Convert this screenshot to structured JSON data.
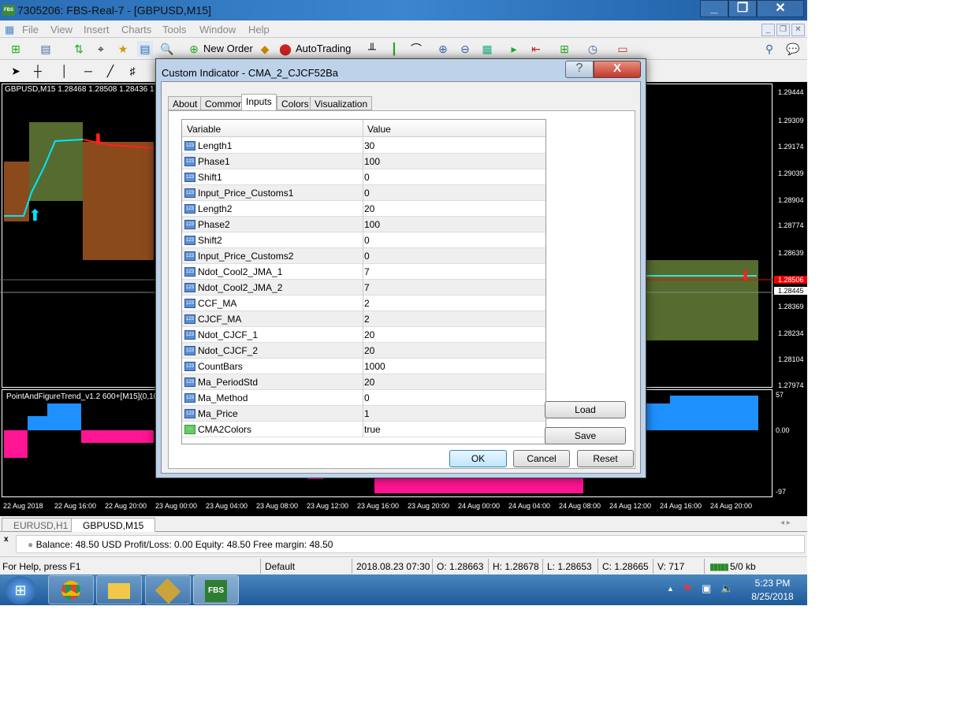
{
  "window": {
    "title": "7305206: FBS-Real-7 - [GBPUSD,M15]",
    "logo": "FBS"
  },
  "menu": [
    "File",
    "View",
    "Insert",
    "Charts",
    "Tools",
    "Window",
    "Help"
  ],
  "toolbar": {
    "new_order": "New Order",
    "autotrading": "AutoTrading"
  },
  "chart": {
    "header": "GBPUSD,M15  1.28468 1.28508 1.28436 1",
    "price_ticks": [
      "1.29444",
      "1.29309",
      "1.29174",
      "1.29039",
      "1.28904",
      "1.28774",
      "1.28639",
      "1.28369",
      "1.28234",
      "1.28104",
      "1.27974"
    ],
    "ask_price": "1.28506",
    "bid_price": "1.28445",
    "indicator_title": "PointAndFigureTrend_v1.2 600+[M15](0,10,",
    "indicator_ticks": [
      "57",
      "0.00",
      "-97"
    ],
    "time_ticks": [
      "22 Aug 2018",
      "22 Aug 16:00",
      "22 Aug 20:00",
      "23 Aug 00:00",
      "23 Aug 04:00",
      "23 Aug 08:00",
      "23 Aug 12:00",
      "23 Aug 16:00",
      "23 Aug 20:00",
      "24 Aug 00:00",
      "24 Aug 04:00",
      "24 Aug 08:00",
      "24 Aug 12:00",
      "24 Aug 16:00",
      "24 Aug 20:00"
    ],
    "colors": {
      "ask": "#ff0000",
      "background": "#000000",
      "box_orange": "#8b4a1c",
      "box_olive": "#556b2f",
      "trend_cyan": "#00e5ff",
      "pf_blue": "#1e90ff",
      "pf_pink": "#ff1493"
    }
  },
  "chart_tabs": [
    "EURUSD,H1",
    "GBPUSD,M15"
  ],
  "terminal": {
    "text": "Balance: 48.50 USD  Profit/Loss: 0.00  Equity: 48.50  Free margin: 48.50"
  },
  "status": {
    "help": "For Help, press F1",
    "profile": "Default",
    "datetime": "2018.08.23 07:30",
    "open": "O: 1.28663",
    "high": "H: 1.28678",
    "low": "L: 1.28653",
    "close": "C: 1.28665",
    "volume": "V: 717",
    "traffic": "5/0 kb"
  },
  "taskbar": {
    "time": "5:23 PM",
    "date": "8/25/2018",
    "fbs": "FBS"
  },
  "dialog": {
    "title": "Custom Indicator - CMA_2_CJCF52Ba",
    "tabs": [
      "About",
      "Common",
      "Inputs",
      "Colors",
      "Visualization"
    ],
    "active_tab": "Inputs",
    "columns": {
      "variable": "Variable",
      "value": "Value"
    },
    "rows": [
      {
        "name": "Length1",
        "value": "30"
      },
      {
        "name": "Phase1",
        "value": "100"
      },
      {
        "name": "Shift1",
        "value": "0"
      },
      {
        "name": "Input_Price_Customs1",
        "value": "0"
      },
      {
        "name": "Length2",
        "value": "20"
      },
      {
        "name": "Phase2",
        "value": "100"
      },
      {
        "name": "Shift2",
        "value": "0"
      },
      {
        "name": "Input_Price_Customs2",
        "value": "0"
      },
      {
        "name": "Ndot_Cool2_JMA_1",
        "value": "7"
      },
      {
        "name": "Ndot_Cool2_JMA_2",
        "value": "7"
      },
      {
        "name": "CCF_MA",
        "value": "2"
      },
      {
        "name": "CJCF_MA",
        "value": "2"
      },
      {
        "name": "Ndot_CJCF_1",
        "value": "20"
      },
      {
        "name": "Ndot_CJCF_2",
        "value": "20"
      },
      {
        "name": "CountBars",
        "value": "1000"
      },
      {
        "name": "Ma_PeriodStd",
        "value": "20"
      },
      {
        "name": "Ma_Method",
        "value": "0"
      },
      {
        "name": "Ma_Price",
        "value": "1"
      },
      {
        "name": "CMA2Colors",
        "value": "true"
      }
    ],
    "buttons": {
      "load": "Load",
      "save": "Save",
      "ok": "OK",
      "cancel": "Cancel",
      "reset": "Reset",
      "help": "?",
      "close": "X"
    }
  }
}
